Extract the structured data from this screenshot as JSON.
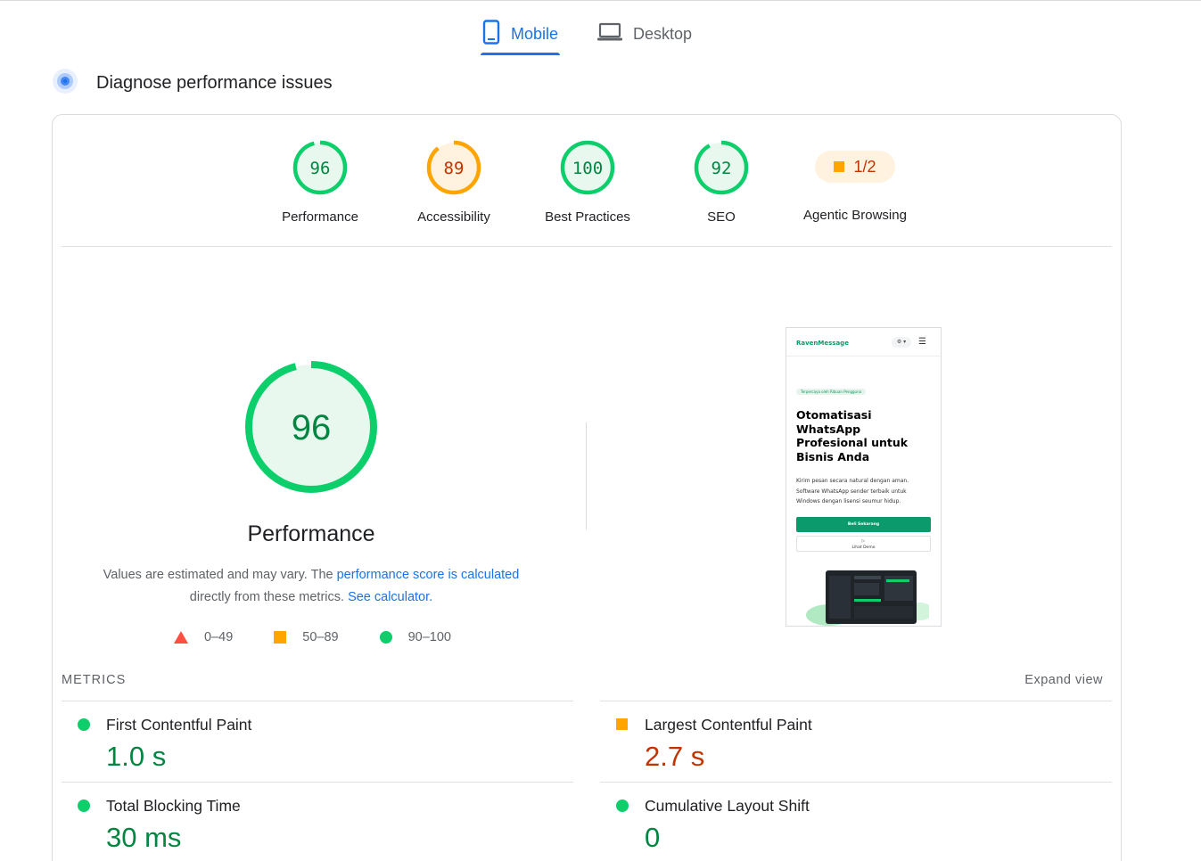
{
  "tabs": {
    "mobile": "Mobile",
    "desktop": "Desktop"
  },
  "diagnose": {
    "title": "Diagnose performance issues"
  },
  "scores": [
    {
      "label": "Performance",
      "value": "96",
      "score": 96,
      "color": "#0cce6b",
      "text_color": "#018642"
    },
    {
      "label": "Accessibility",
      "value": "89",
      "score": 89,
      "color": "#ffa400",
      "text_color": "#c33300"
    },
    {
      "label": "Best Practices",
      "value": "100",
      "score": 100,
      "color": "#0cce6b",
      "text_color": "#018642"
    },
    {
      "label": "SEO",
      "value": "92",
      "score": 92,
      "color": "#0cce6b",
      "text_color": "#018642"
    }
  ],
  "agentic": {
    "label": "Agentic Browsing",
    "value": "1/2"
  },
  "performance": {
    "score": "96",
    "title": "Performance",
    "note_prefix": "Values are estimated and may vary. The ",
    "note_link1": "performance score is calculated",
    "note_mid": " directly from these metrics. ",
    "note_link2": "See calculator."
  },
  "legend": {
    "bad": "0–49",
    "average": "50–89",
    "good": "90–100"
  },
  "preview": {
    "brand": "RavenMessage",
    "toggle": "⚙ ▾",
    "menu": "☰",
    "pill": "Terpercaya oleh Ribuan Pengguna",
    "headline": "Otomatisasi WhatsApp Profesional untuk Bisnis Anda",
    "body": "Kirim pesan secara natural dengan aman. Software WhatsApp sender terbaik untuk Windows dengan lisensi seumur hidup.",
    "cta": "Beli Sekarang",
    "demo_icon": "▷",
    "demo": "Lihat Demo"
  },
  "metrics": {
    "heading": "METRICS",
    "expand": "Expand view",
    "items": [
      {
        "name": "First Contentful Paint",
        "value": "1.0 s",
        "rating": "good"
      },
      {
        "name": "Largest Contentful Paint",
        "value": "2.7 s",
        "rating": "average"
      },
      {
        "name": "Total Blocking Time",
        "value": "30 ms",
        "rating": "good"
      },
      {
        "name": "Cumulative Layout Shift",
        "value": "0",
        "rating": "good"
      }
    ]
  },
  "colors": {
    "accent": "#1a73e8",
    "good": "#0cce6b",
    "average": "#ffa400",
    "bad": "#ff4e42"
  }
}
